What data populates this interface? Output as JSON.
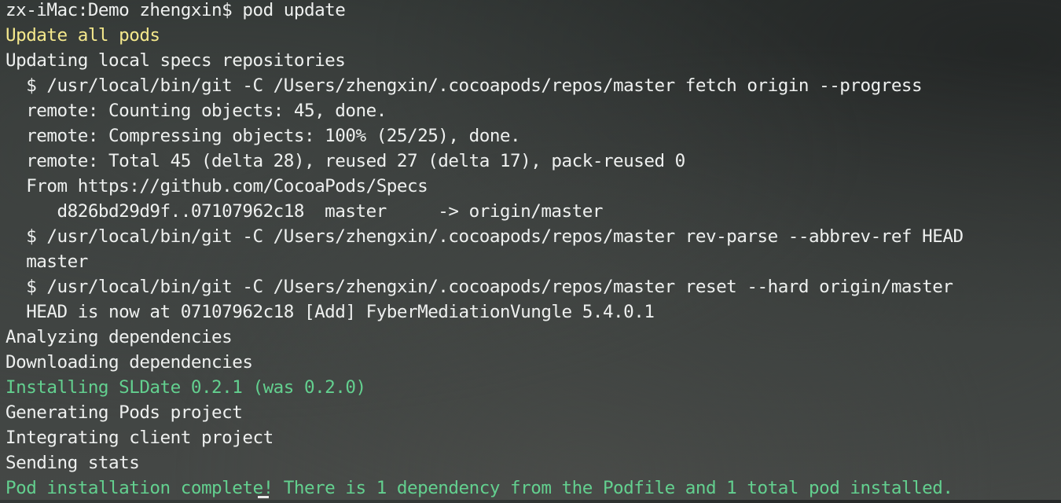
{
  "terminal": {
    "lines": [
      {
        "text": "zx-iMac:Demo zhengxin$ pod update",
        "style": "normal"
      },
      {
        "text": "Update all pods",
        "style": "yellow"
      },
      {
        "text": "Updating local specs repositories",
        "style": "normal"
      },
      {
        "text": "  $ /usr/local/bin/git -C /Users/zhengxin/.cocoapods/repos/master fetch origin --progress",
        "style": "normal"
      },
      {
        "text": "  remote: Counting objects: 45, done.",
        "style": "normal"
      },
      {
        "text": "  remote: Compressing objects: 100% (25/25), done.",
        "style": "normal"
      },
      {
        "text": "  remote: Total 45 (delta 28), reused 27 (delta 17), pack-reused 0",
        "style": "normal"
      },
      {
        "text": "  From https://github.com/CocoaPods/Specs",
        "style": "normal"
      },
      {
        "text": "     d826bd29d9f..07107962c18  master     -> origin/master",
        "style": "normal"
      },
      {
        "text": "  $ /usr/local/bin/git -C /Users/zhengxin/.cocoapods/repos/master rev-parse --abbrev-ref HEAD",
        "style": "normal"
      },
      {
        "text": "  master",
        "style": "normal"
      },
      {
        "text": "  $ /usr/local/bin/git -C /Users/zhengxin/.cocoapods/repos/master reset --hard origin/master",
        "style": "normal"
      },
      {
        "text": "  HEAD is now at 07107962c18 [Add] FyberMediationVungle 5.4.0.1",
        "style": "normal"
      },
      {
        "text": "Analyzing dependencies",
        "style": "normal"
      },
      {
        "text": "Downloading dependencies",
        "style": "normal"
      },
      {
        "text": "Installing SLDate 0.2.1 (was 0.2.0)",
        "style": "green"
      },
      {
        "text": "Generating Pods project",
        "style": "normal"
      },
      {
        "text": "Integrating client project",
        "style": "normal"
      },
      {
        "text": "Sending stats",
        "style": "normal"
      },
      {
        "text": "Pod installation complete! There is 1 dependency from the Podfile and 1 total pod installed.",
        "style": "green"
      }
    ]
  },
  "colors": {
    "text": "#eef0ef",
    "yellow": "#f4e88c",
    "green": "#63d08f",
    "background": "#3a3e3c"
  }
}
